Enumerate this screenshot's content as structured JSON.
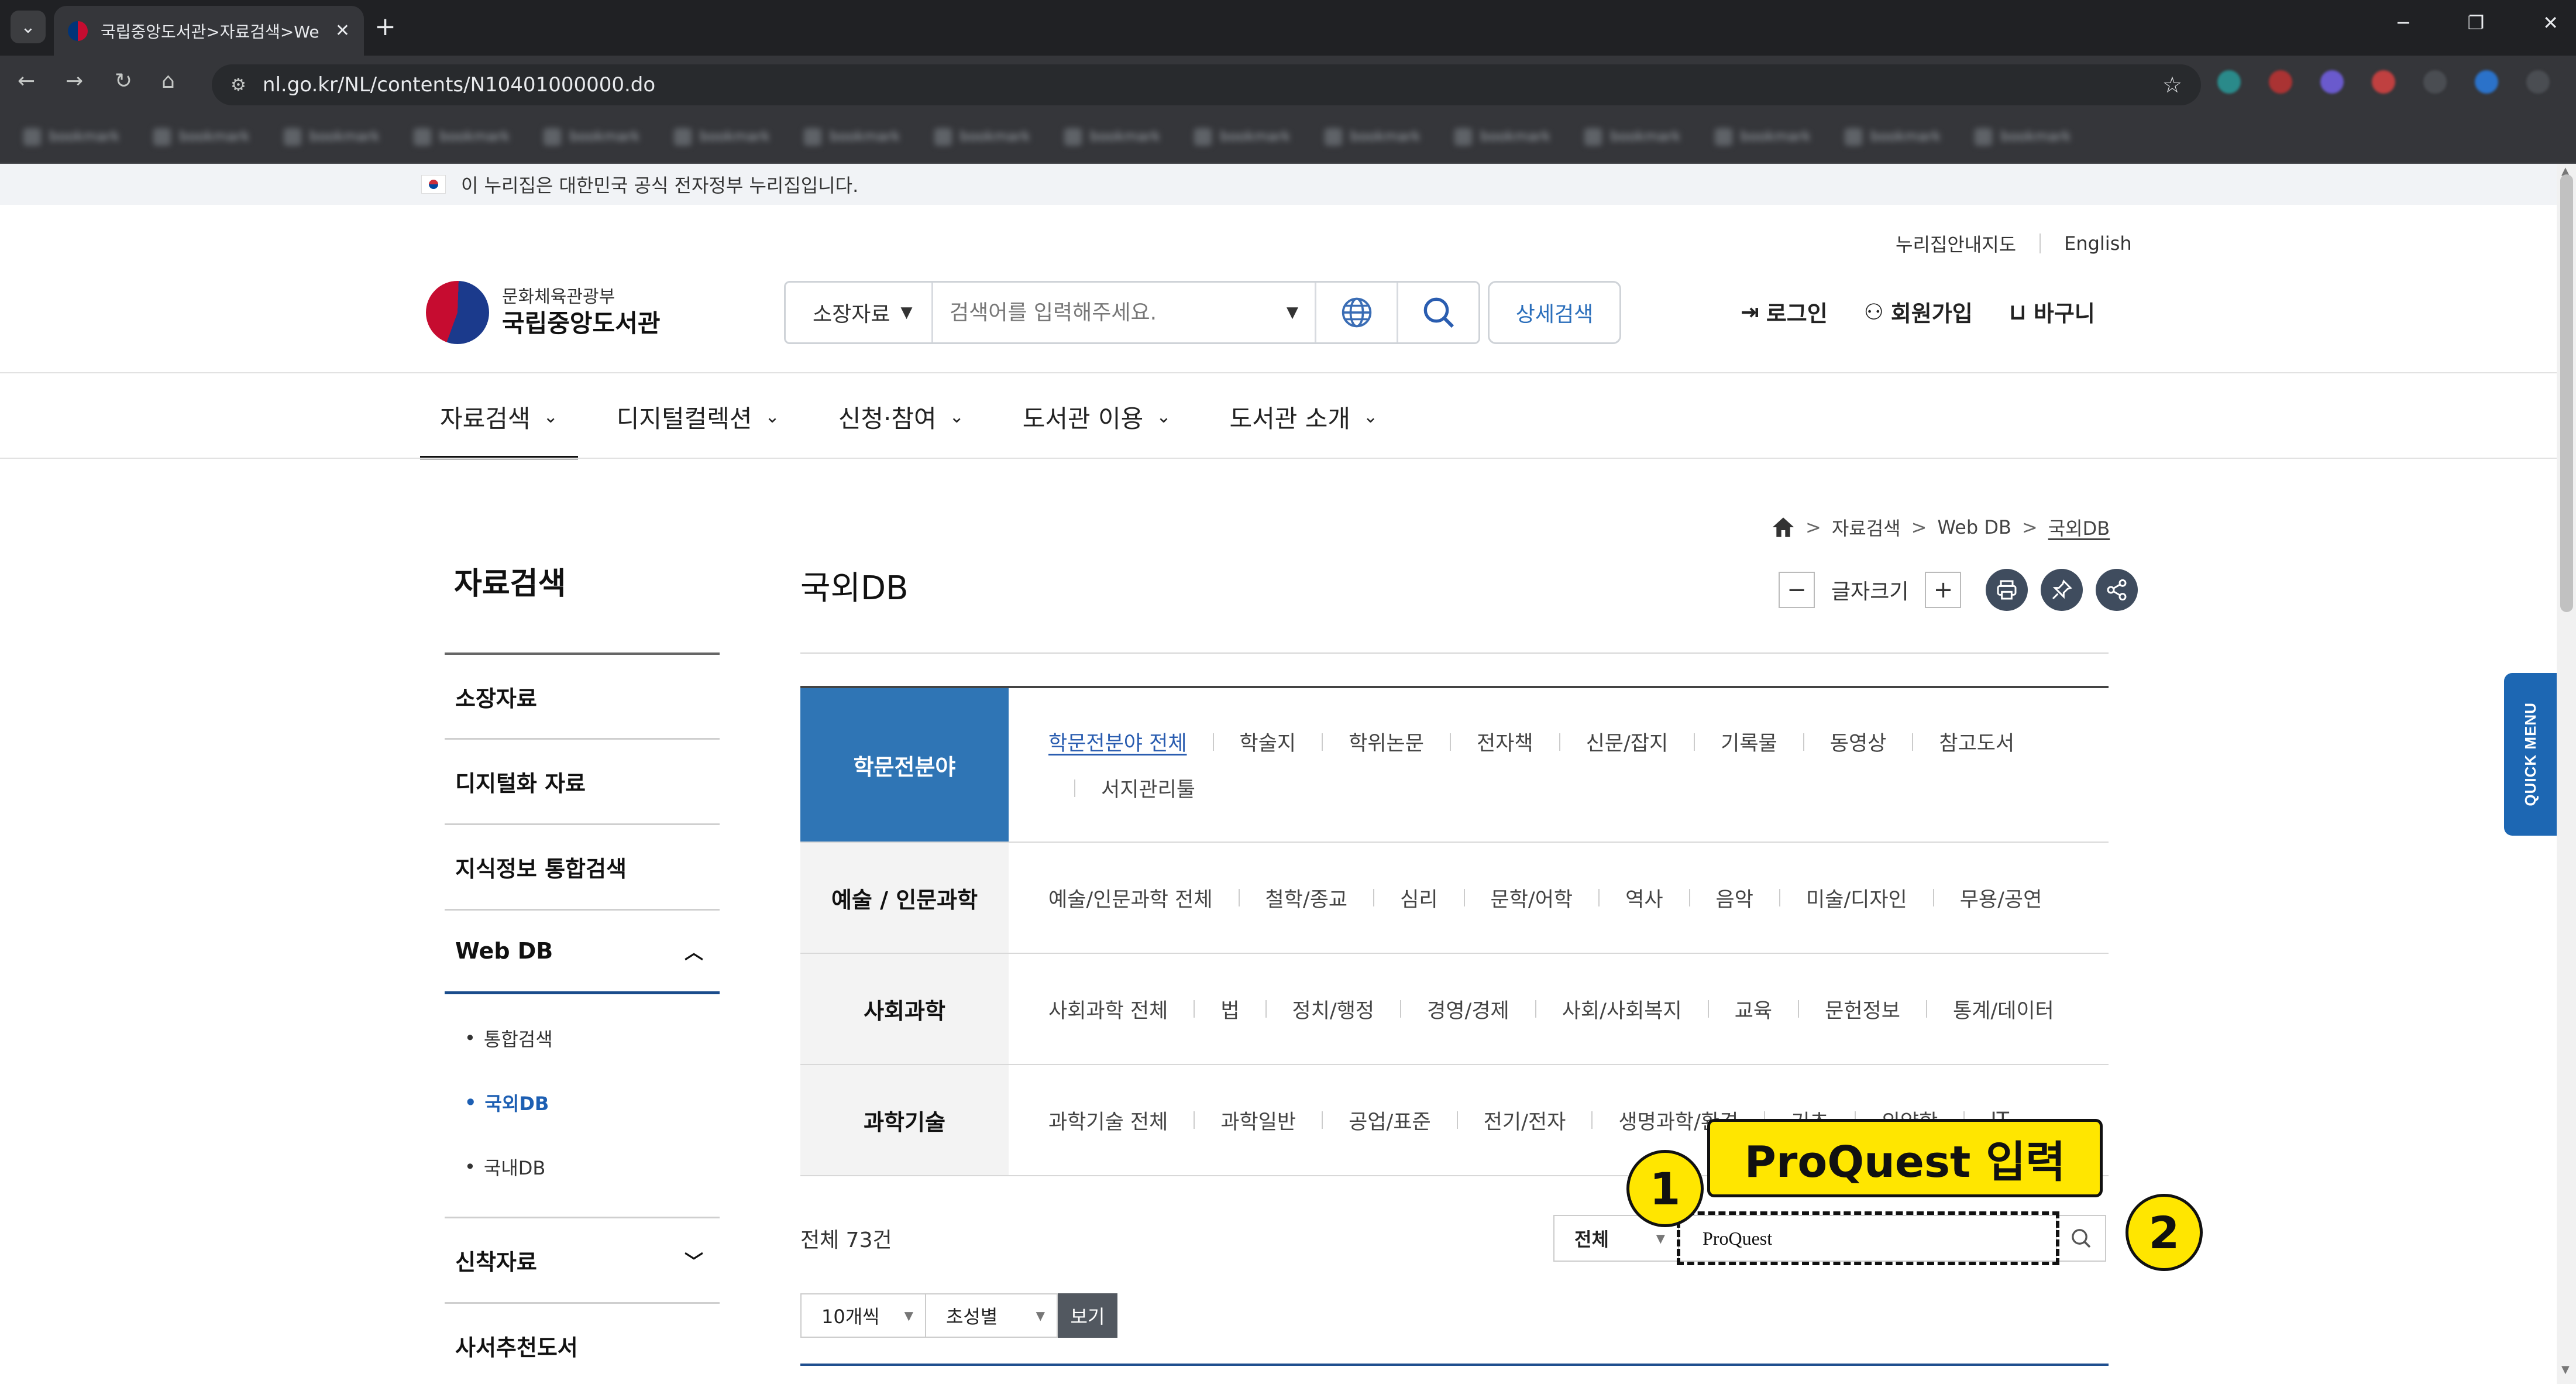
{
  "browser": {
    "tab_title": "국립중앙도서관>자료검색>We",
    "url": "nl.go.kr/NL/contents/N10401000000.do",
    "bookmarks": [
      "bookmark",
      "bookmark",
      "bookmark",
      "bookmark",
      "bookmark",
      "bookmark",
      "bookmark",
      "bookmark",
      "bookmark",
      "bookmark",
      "bookmark",
      "bookmark",
      "bookmark",
      "bookmark",
      "bookmark",
      "bookmark"
    ]
  },
  "gov_banner": "이 누리집은 대한민국 공식 전자정부 누리집입니다.",
  "header": {
    "util_links": [
      "누리집안내지도",
      "English"
    ],
    "logo_sub": "문화체육관광부",
    "logo_main": "국립중앙도서관",
    "search_scope": "소장자료",
    "search_placeholder": "검색어를 입력해주세요.",
    "advanced_search": "상세검색",
    "login": "로그인",
    "signup": "회원가입",
    "cart": "바구니"
  },
  "gnb": [
    "자료검색",
    "디지털컬렉션",
    "신청·참여",
    "도서관 이용",
    "도서관 소개"
  ],
  "breadcrumb": [
    "자료검색",
    "Web DB",
    "국외DB"
  ],
  "lnb": {
    "title": "자료검색",
    "items": [
      "소장자료",
      "디지털화 자료",
      "지식정보 통합검색",
      "Web DB"
    ],
    "webdb_sub": [
      "통합검색",
      "국외DB",
      "국내DB"
    ],
    "after_items": [
      "신착자료",
      "사서추천도서"
    ]
  },
  "content": {
    "title": "국외DB",
    "font_size_label": "글자크기",
    "categories": [
      {
        "head": "학문전분야",
        "links": [
          "학문전분야 전체",
          "학술지",
          "학위논문",
          "전자책",
          "신문/잡지",
          "기록물",
          "동영상",
          "참고도서",
          "서지관리툴"
        ]
      },
      {
        "head": "예술 / 인문과학",
        "links": [
          "예술/인문과학 전체",
          "철학/종교",
          "심리",
          "문학/어학",
          "역사",
          "음악",
          "미술/디자인",
          "무용/공연"
        ]
      },
      {
        "head": "사회과학",
        "links": [
          "사회과학 전체",
          "법",
          "정치/행정",
          "경영/경제",
          "사회/사회복지",
          "교육",
          "문헌정보",
          "통계/데이터"
        ]
      },
      {
        "head": "과학기술",
        "links": [
          "과학기술 전체",
          "과학일반",
          "공업/표준",
          "전기/전자",
          "생명과학/환경",
          "기초",
          "의약학",
          "IT"
        ]
      }
    ],
    "total": "전체 73건",
    "filter_scope": "전체",
    "filter_value": "ProQuest",
    "per_page": "10개씩",
    "sort": "초성별",
    "view_button": "보기"
  },
  "quick_menu": "QUICK MENU",
  "annotations": {
    "step1": "1",
    "step2": "2",
    "callout": "ProQuest 입력"
  },
  "colors": {
    "accent_blue": "#2f75b5",
    "annotation_yellow": "#ffe600",
    "quick_menu_blue": "#1d67b3"
  }
}
